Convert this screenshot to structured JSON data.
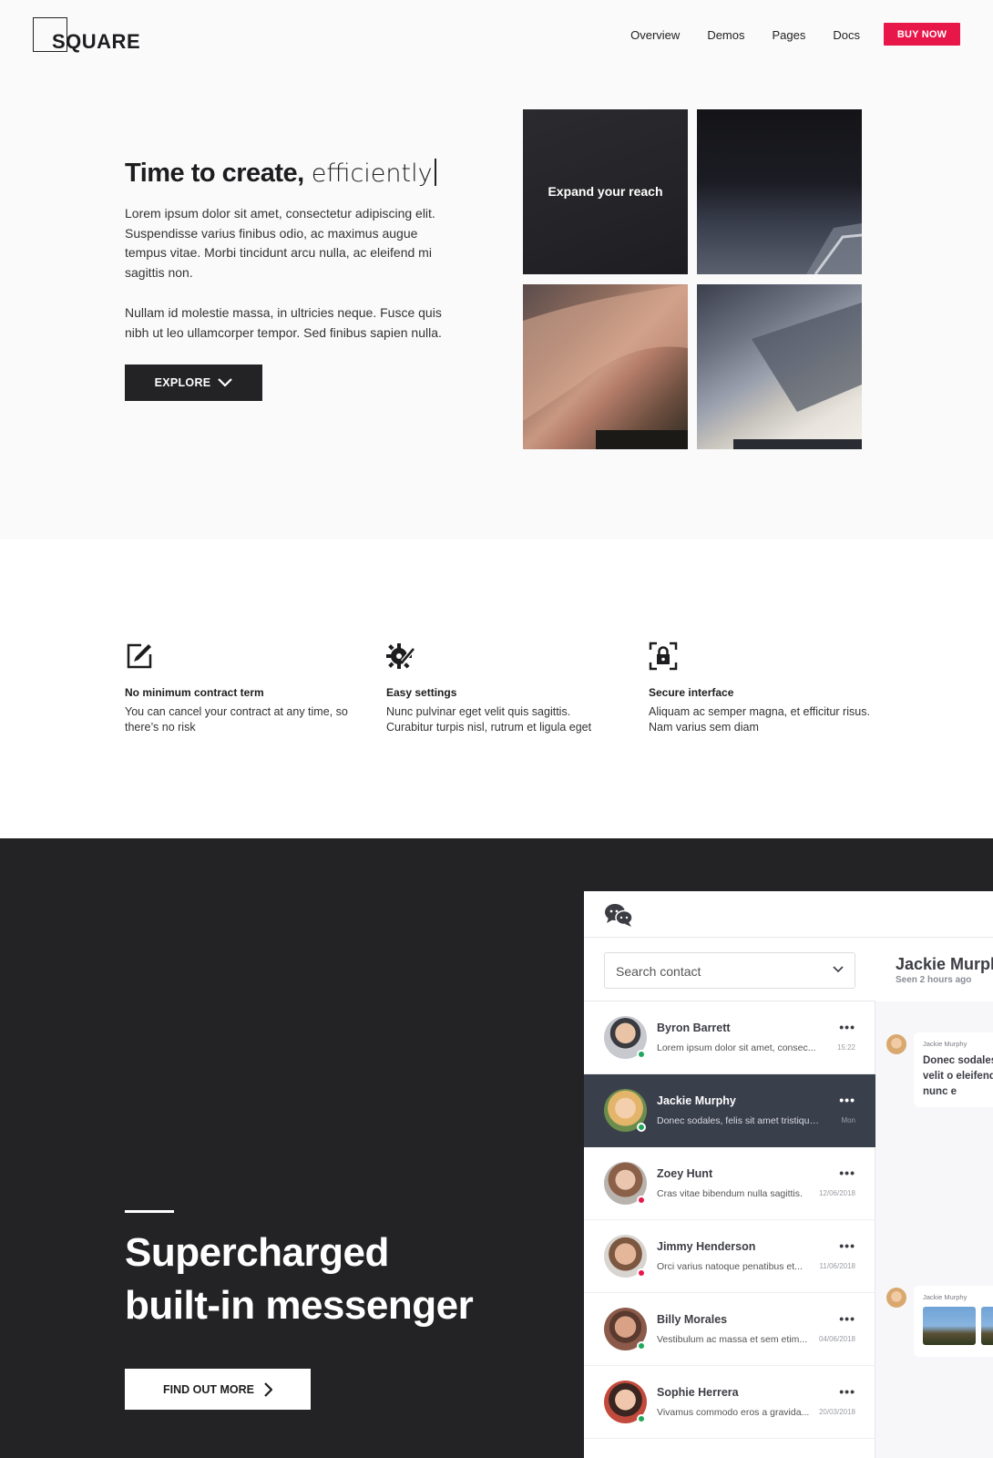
{
  "header": {
    "logo_text": "SQUARE",
    "nav": [
      "Overview",
      "Demos",
      "Pages",
      "Docs"
    ],
    "cta": "BUY NOW",
    "accent": "#e8174a"
  },
  "hero": {
    "title_bold": "Time to create,",
    "title_light": "efficiently",
    "paragraph1": "Lorem ipsum dolor sit amet, consectetur adipiscing elit. Suspendisse varius finibus odio, ac maximus augue tempus vitae. Morbi tincidunt arcu nulla, ac eleifend mi sagittis non.",
    "paragraph2": "Nullam id molestie massa, in ultricies neque. Fusce quis nibh ut leo ullamcorper tempor. Sed finibus sapien nulla.",
    "button": "EXPLORE",
    "tile_caption": "Expand your reach"
  },
  "features": [
    {
      "icon": "edit-icon",
      "title": "No minimum contract term",
      "text": "You can cancel your contract at any time, so there’s no risk"
    },
    {
      "icon": "settings-icon",
      "title": "Easy settings",
      "text": "Nunc pulvinar eget velit quis sagittis. Curabitur turpis nisl, rutrum et ligula eget"
    },
    {
      "icon": "secure-lock-icon",
      "title": "Secure interface",
      "text": "Aliquam ac semper magna, et efficitur risus. Nam varius sem diam"
    }
  ],
  "messenger_section": {
    "title_line1": "Supercharged",
    "title_line2": "built-in messenger",
    "button": "FIND OUT MORE"
  },
  "messenger": {
    "search_placeholder": "Search contact",
    "active_chat": {
      "name": "Jackie Murphy",
      "status": "Seen 2 hours ago"
    },
    "contacts": [
      {
        "name": "Byron Barrett",
        "preview": "Lorem ipsum dolor sit amet, consec...",
        "time": "15:22",
        "online": "#1fa75c",
        "active": false
      },
      {
        "name": "Jackie Murphy",
        "preview": "Donec sodales, felis sit amet tristique...",
        "time": "Mon",
        "online": "#1fa75c",
        "active": true
      },
      {
        "name": "Zoey Hunt",
        "preview": "Cras vitae bibendum nulla sagittis.",
        "time": "12/06/2018",
        "online": "#e8174a",
        "active": false
      },
      {
        "name": "Jimmy Henderson",
        "preview": "Orci varius natoque penatibus et...",
        "time": "11/06/2018",
        "online": "#e8174a",
        "active": false
      },
      {
        "name": "Billy Morales",
        "preview": "Vestibulum ac massa et sem etim...",
        "time": "04/06/2018",
        "online": "#1fa75c",
        "active": false
      },
      {
        "name": "Sophie Herrera",
        "preview": "Vivamus commodo eros a gravida...",
        "time": "20/03/2018",
        "online": "#1fa75c",
        "active": false
      }
    ],
    "messages": [
      {
        "from": "Jackie Murphy",
        "text": "Donec sodales, velit o eleifend nunc e"
      },
      {
        "from": "Jackie Murphy",
        "text": ""
      }
    ]
  }
}
